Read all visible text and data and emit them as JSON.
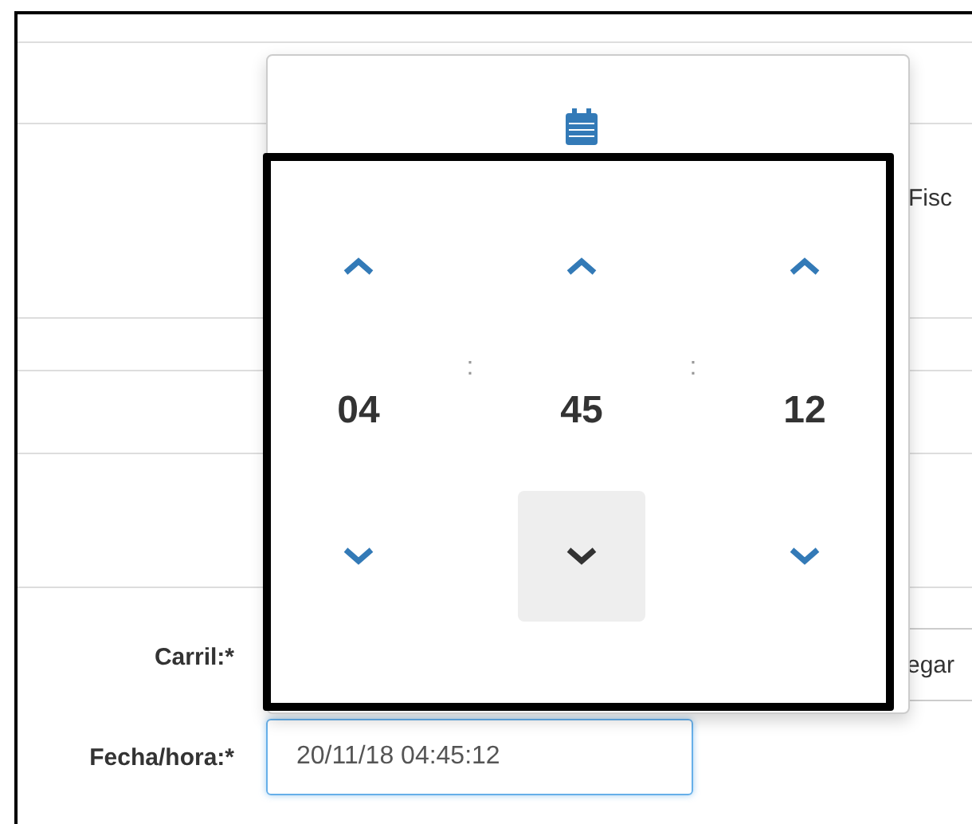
{
  "form": {
    "partial_label": "Fisc",
    "lane": {
      "label": "Carril:*",
      "partial_value": "egar"
    },
    "datetime": {
      "label": "Fecha/hora:*",
      "value": "20/11/18 04:45:12",
      "focused": true
    }
  },
  "time_picker": {
    "columns": [
      {
        "value": "04",
        "down_hovered": false
      },
      {
        "value": "45",
        "down_hovered": true
      },
      {
        "value": "12",
        "down_hovered": false
      }
    ],
    "separators": [
      ":",
      ":"
    ]
  }
}
